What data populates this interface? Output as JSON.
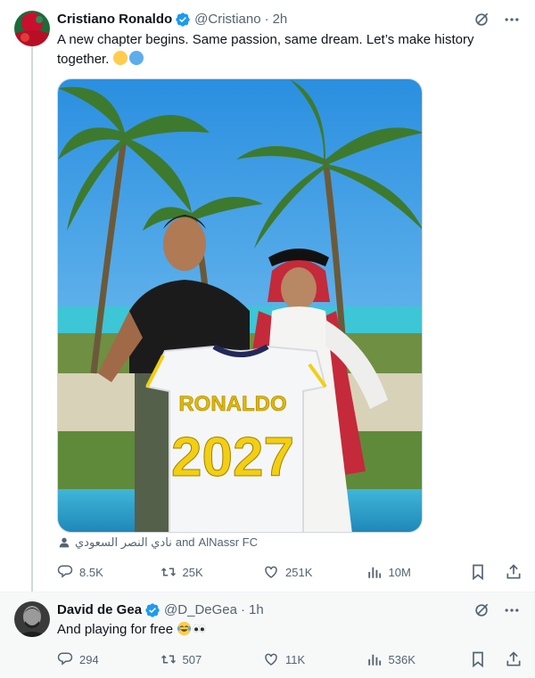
{
  "tweets": [
    {
      "author_name": "Cristiano Ronaldo",
      "handle": "@Cristiano",
      "time": "2h",
      "text": "A new chapter begins. Same passion, same dream. Let’s make history together.",
      "emojis": [
        "yellow-heart",
        "blue-heart"
      ],
      "media": {
        "shirt_name": "RONALDO",
        "shirt_number": "2027"
      },
      "tagged": {
        "arabic": "نادي النصر السعودي",
        "joiner": "and",
        "account": "AlNassr FC"
      },
      "stats": {
        "replies": "8.5K",
        "retweets": "25K",
        "likes": "251K",
        "views": "10M"
      }
    },
    {
      "author_name": "David de Gea",
      "handle": "@D_DeGea",
      "time": "1h",
      "text": "And playing for free",
      "emojis": [
        "tears-of-joy",
        "eyes"
      ],
      "stats": {
        "replies": "294",
        "retweets": "507",
        "likes": "11K",
        "views": "536K"
      }
    }
  ],
  "icons": {
    "verified": "verified-badge-icon",
    "grok": "grok-icon",
    "more": "more-icon",
    "reply": "reply-icon",
    "retweet": "retweet-icon",
    "like": "like-icon",
    "views": "views-icon",
    "bookmark": "bookmark-icon",
    "share": "share-icon"
  },
  "colors": {
    "verified_blue": "#1d9bf0",
    "secondary_text": "#536471",
    "primary_text": "#0f1419",
    "jersey_yellow": "#f2cf12"
  }
}
